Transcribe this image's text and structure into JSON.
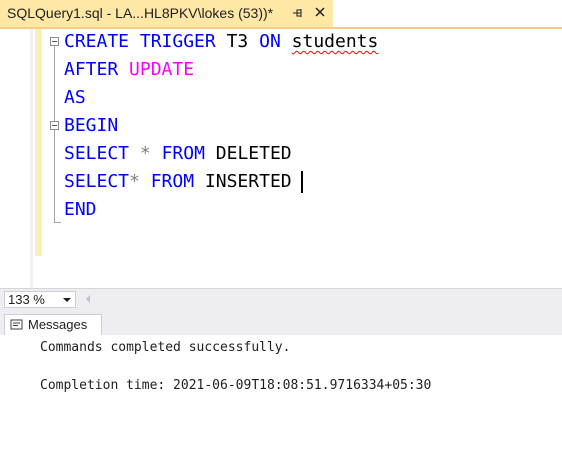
{
  "document_tab": {
    "title": "SQLQuery1.sql - LA...HL8PKV\\lokes (53))*"
  },
  "code": {
    "line1": {
      "kw_create": "CREATE",
      "kw_trigger": "TRIGGER",
      "name": "T3",
      "kw_on": "ON",
      "table": "students"
    },
    "line2": {
      "kw_after": "AFTER",
      "fn_update": "UPDATE"
    },
    "line3": {
      "kw_as": "AS"
    },
    "line4": {
      "kw_begin": "BEGIN"
    },
    "line5": {
      "kw_select": "SELECT",
      "star": "*",
      "kw_from": "FROM",
      "table": "DELETED"
    },
    "line6": {
      "kw_select": "SELECT",
      "star": "*",
      "kw_from": "FROM",
      "table": "INSERTED"
    },
    "line7": {
      "kw_end": "END"
    }
  },
  "status": {
    "zoom": "133 %"
  },
  "results": {
    "tab_label": "Messages",
    "messages": [
      "Commands completed successfully.",
      "Completion time: 2021-06-09T18:08:51.9716334+05:30"
    ]
  },
  "colors": {
    "active_tab": "#ffe8a6",
    "keyword": "#0000ff",
    "function": "#ff00ff",
    "change_bar": "#fbf0b5"
  }
}
